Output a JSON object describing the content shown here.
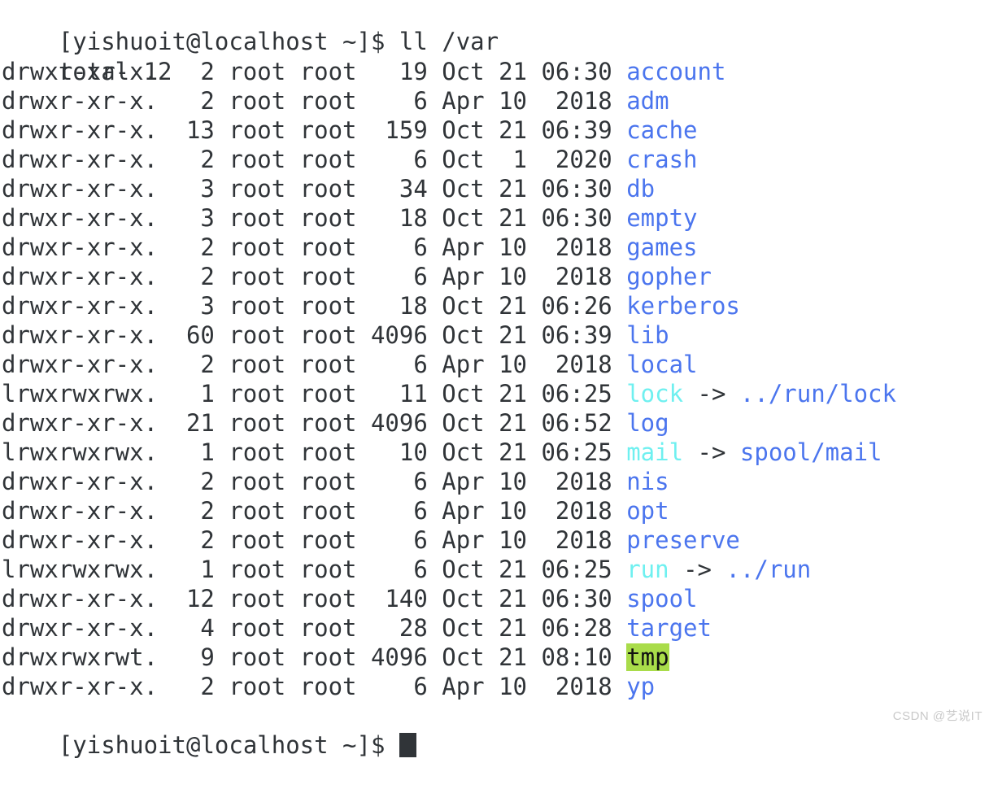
{
  "terminal": {
    "background_color": "#ffffff",
    "foreground_color": "#303438",
    "dir_color": "#4b75ee",
    "symlink_color": "#6ff0f0",
    "sticky_bg_color": "#a9dc4a",
    "sticky_fg_color": "#111111",
    "cursor_color": "#303438"
  },
  "prompt_top": {
    "prompt": "[yishuoit@localhost ~]$ ",
    "command": "ll /var"
  },
  "total_line": "total 12",
  "listing": [
    {
      "perms": "drwxr-xr-x.",
      "links": "  2",
      "owner": "root",
      "group": "root",
      "size": "  19",
      "month": "Oct",
      "day": "21",
      "time": "06:30",
      "name": "account",
      "type": "dir"
    },
    {
      "perms": "drwxr-xr-x.",
      "links": "  2",
      "owner": "root",
      "group": "root",
      "size": "   6",
      "month": "Apr",
      "day": "10",
      "time": " 2018",
      "name": "adm",
      "type": "dir"
    },
    {
      "perms": "drwxr-xr-x.",
      "links": " 13",
      "owner": "root",
      "group": "root",
      "size": " 159",
      "month": "Oct",
      "day": "21",
      "time": "06:39",
      "name": "cache",
      "type": "dir"
    },
    {
      "perms": "drwxr-xr-x.",
      "links": "  2",
      "owner": "root",
      "group": "root",
      "size": "   6",
      "month": "Oct",
      "day": " 1",
      "time": " 2020",
      "name": "crash",
      "type": "dir"
    },
    {
      "perms": "drwxr-xr-x.",
      "links": "  3",
      "owner": "root",
      "group": "root",
      "size": "  34",
      "month": "Oct",
      "day": "21",
      "time": "06:30",
      "name": "db",
      "type": "dir"
    },
    {
      "perms": "drwxr-xr-x.",
      "links": "  3",
      "owner": "root",
      "group": "root",
      "size": "  18",
      "month": "Oct",
      "day": "21",
      "time": "06:30",
      "name": "empty",
      "type": "dir"
    },
    {
      "perms": "drwxr-xr-x.",
      "links": "  2",
      "owner": "root",
      "group": "root",
      "size": "   6",
      "month": "Apr",
      "day": "10",
      "time": " 2018",
      "name": "games",
      "type": "dir"
    },
    {
      "perms": "drwxr-xr-x.",
      "links": "  2",
      "owner": "root",
      "group": "root",
      "size": "   6",
      "month": "Apr",
      "day": "10",
      "time": " 2018",
      "name": "gopher",
      "type": "dir"
    },
    {
      "perms": "drwxr-xr-x.",
      "links": "  3",
      "owner": "root",
      "group": "root",
      "size": "  18",
      "month": "Oct",
      "day": "21",
      "time": "06:26",
      "name": "kerberos",
      "type": "dir"
    },
    {
      "perms": "drwxr-xr-x.",
      "links": " 60",
      "owner": "root",
      "group": "root",
      "size": "4096",
      "month": "Oct",
      "day": "21",
      "time": "06:39",
      "name": "lib",
      "type": "dir"
    },
    {
      "perms": "drwxr-xr-x.",
      "links": "  2",
      "owner": "root",
      "group": "root",
      "size": "   6",
      "month": "Apr",
      "day": "10",
      "time": " 2018",
      "name": "local",
      "type": "dir"
    },
    {
      "perms": "lrwxrwxrwx.",
      "links": "  1",
      "owner": "root",
      "group": "root",
      "size": "  11",
      "month": "Oct",
      "day": "21",
      "time": "06:25",
      "name": "lock",
      "type": "link",
      "arrow": " -> ",
      "target": "../run/lock"
    },
    {
      "perms": "drwxr-xr-x.",
      "links": " 21",
      "owner": "root",
      "group": "root",
      "size": "4096",
      "month": "Oct",
      "day": "21",
      "time": "06:52",
      "name": "log",
      "type": "dir"
    },
    {
      "perms": "lrwxrwxrwx.",
      "links": "  1",
      "owner": "root",
      "group": "root",
      "size": "  10",
      "month": "Oct",
      "day": "21",
      "time": "06:25",
      "name": "mail",
      "type": "link",
      "arrow": " -> ",
      "target": "spool/mail"
    },
    {
      "perms": "drwxr-xr-x.",
      "links": "  2",
      "owner": "root",
      "group": "root",
      "size": "   6",
      "month": "Apr",
      "day": "10",
      "time": " 2018",
      "name": "nis",
      "type": "dir"
    },
    {
      "perms": "drwxr-xr-x.",
      "links": "  2",
      "owner": "root",
      "group": "root",
      "size": "   6",
      "month": "Apr",
      "day": "10",
      "time": " 2018",
      "name": "opt",
      "type": "dir"
    },
    {
      "perms": "drwxr-xr-x.",
      "links": "  2",
      "owner": "root",
      "group": "root",
      "size": "   6",
      "month": "Apr",
      "day": "10",
      "time": " 2018",
      "name": "preserve",
      "type": "dir"
    },
    {
      "perms": "lrwxrwxrwx.",
      "links": "  1",
      "owner": "root",
      "group": "root",
      "size": "   6",
      "month": "Oct",
      "day": "21",
      "time": "06:25",
      "name": "run",
      "type": "link",
      "arrow": " -> ",
      "target": "../run"
    },
    {
      "perms": "drwxr-xr-x.",
      "links": " 12",
      "owner": "root",
      "group": "root",
      "size": " 140",
      "month": "Oct",
      "day": "21",
      "time": "06:30",
      "name": "spool",
      "type": "dir"
    },
    {
      "perms": "drwxr-xr-x.",
      "links": "  4",
      "owner": "root",
      "group": "root",
      "size": "  28",
      "month": "Oct",
      "day": "21",
      "time": "06:28",
      "name": "target",
      "type": "dir"
    },
    {
      "perms": "drwxrwxrwt.",
      "links": "  9",
      "owner": "root",
      "group": "root",
      "size": "4096",
      "month": "Oct",
      "day": "21",
      "time": "08:10",
      "name": "tmp",
      "type": "sticky"
    },
    {
      "perms": "drwxr-xr-x.",
      "links": "  2",
      "owner": "root",
      "group": "root",
      "size": "   6",
      "month": "Apr",
      "day": "10",
      "time": " 2018",
      "name": "yp",
      "type": "dir"
    }
  ],
  "prompt_bottom": {
    "prompt": "[yishuoit@localhost ~]$ "
  },
  "watermark": "CSDN @艺说IT"
}
